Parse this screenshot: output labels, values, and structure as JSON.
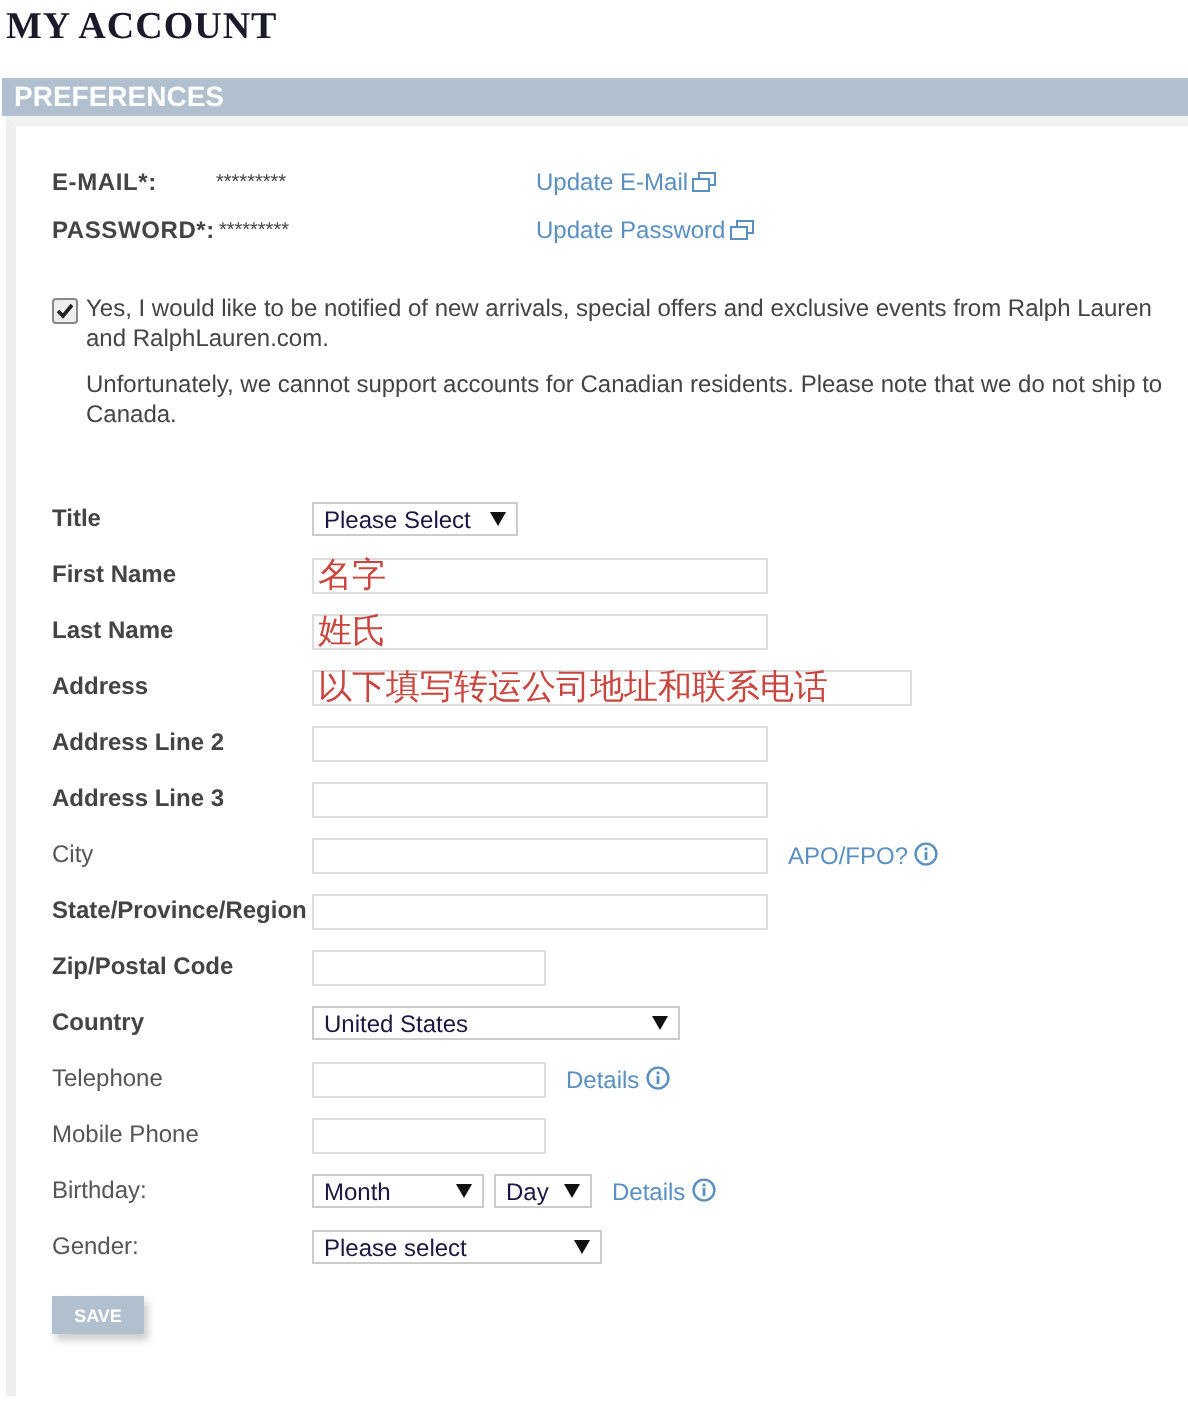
{
  "page_title": "MY ACCOUNT",
  "section": {
    "title": "PREFERENCES"
  },
  "credentials": [
    {
      "label": "E-MAIL*:",
      "value": "*********",
      "link": "Update E-Mail"
    },
    {
      "label": "PASSWORD*:",
      "value": "*********",
      "link": "Update Password"
    }
  ],
  "newsletter": {
    "checked": true,
    "text": "Yes, I would like to be notified of new arrivals, special offers and exclusive events from Ralph Lauren and RalphLauren.com.",
    "note": "Unfortunately, we cannot support accounts for Canadian residents. Please note that we do not ship to Canada."
  },
  "fields": [
    {
      "label": "Title",
      "required": true,
      "controls": [
        {
          "kind": "select",
          "value": "Please Select"
        }
      ]
    },
    {
      "label": "First Name",
      "required": true,
      "controls": [
        {
          "kind": "input",
          "value": "名字"
        }
      ]
    },
    {
      "label": "Last Name",
      "required": true,
      "controls": [
        {
          "kind": "input",
          "value": "姓氏"
        }
      ]
    },
    {
      "label": "Address",
      "required": true,
      "controls": [
        {
          "kind": "input",
          "value": "以下填写转运公司地址和联系电话"
        }
      ]
    },
    {
      "label": "Address Line 2",
      "required": true,
      "controls": [
        {
          "kind": "input"
        }
      ]
    },
    {
      "label": "Address Line 3",
      "required": true,
      "controls": [
        {
          "kind": "input"
        }
      ]
    },
    {
      "label": "City",
      "required": false,
      "controls": [
        {
          "kind": "input"
        }
      ],
      "link": "APO/FPO?"
    },
    {
      "label": "State/Province/Region",
      "required": true,
      "controls": [
        {
          "kind": "input"
        }
      ]
    },
    {
      "label": "Zip/Postal Code",
      "required": true,
      "controls": [
        {
          "kind": "input"
        }
      ]
    },
    {
      "label": "Country",
      "required": true,
      "controls": [
        {
          "kind": "select",
          "value": "United States"
        }
      ]
    },
    {
      "label": "Telephone",
      "required": false,
      "controls": [
        {
          "kind": "input"
        }
      ],
      "link": "Details"
    },
    {
      "label": "Mobile Phone",
      "required": false,
      "controls": [
        {
          "kind": "input"
        }
      ]
    },
    {
      "label": "Birthday:",
      "required": false,
      "controls": [
        {
          "kind": "select",
          "value": "Month"
        },
        {
          "kind": "select",
          "value": "Day"
        }
      ],
      "link": "Details"
    },
    {
      "label": "Gender:",
      "required": false,
      "controls": [
        {
          "kind": "select",
          "value": "Please select"
        }
      ]
    }
  ],
  "save_button": "SAVE"
}
